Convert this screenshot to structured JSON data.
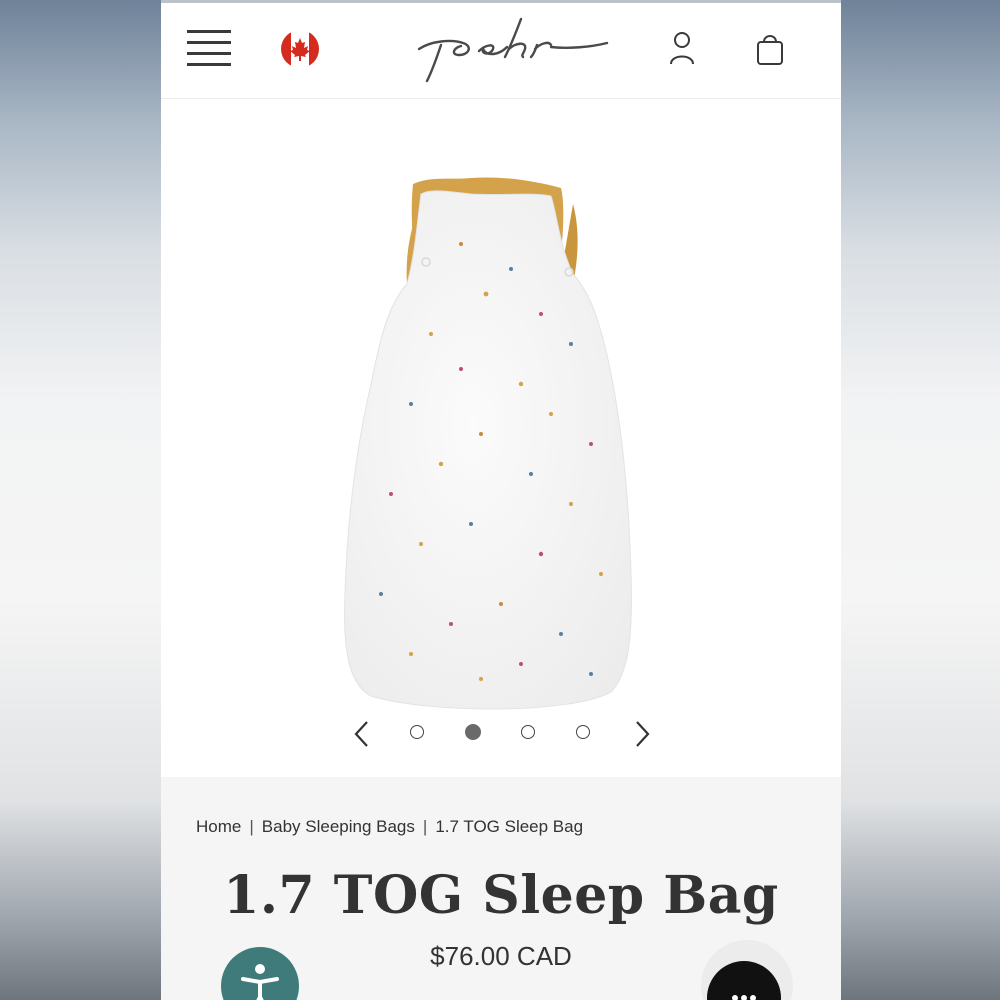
{
  "header": {
    "menu_icon": "hamburger-menu-icon",
    "flag_icon": "canada-flag-icon",
    "logo_text": "pehr",
    "account_icon": "user-icon",
    "cart_icon": "shopping-bag-icon"
  },
  "gallery": {
    "image_alt": "1.7 TOG Sleep Bag",
    "slide_count": 4,
    "active_slide": 2,
    "prev_icon": "chevron-left-icon",
    "next_icon": "chevron-right-icon"
  },
  "breadcrumb": {
    "items": [
      "Home",
      "Baby Sleeping Bags",
      "1.7 TOG Sleep Bag"
    ],
    "separator": "|"
  },
  "product": {
    "title": "1.7 TOG Sleep Bag",
    "price": "$76.00 CAD"
  },
  "floating": {
    "accessibility_icon": "accessibility-icon",
    "chat_icon": "chat-dots-icon"
  },
  "colors": {
    "accent_teal": "#3f7b7b",
    "text": "#333333",
    "mustard": "#d4a24a"
  }
}
